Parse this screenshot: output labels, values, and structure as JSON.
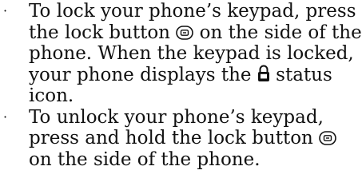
{
  "bullets": [
    {
      "marker": "·",
      "text_before_icon": "To lock your phone’s keypad, press the lock button",
      "icon": "lock-button-icon",
      "text_middle": "on the side of the phone. When the keypad is locked, your phone displays the",
      "status_icon": "padlock-status-icon",
      "text_after_icon": "status icon."
    },
    {
      "marker": "·",
      "text_before_icon": "To unlock your phone’s keypad, press and hold the lock button",
      "icon": "lock-button-icon",
      "text_after_icon": "on the side of the phone."
    }
  ]
}
